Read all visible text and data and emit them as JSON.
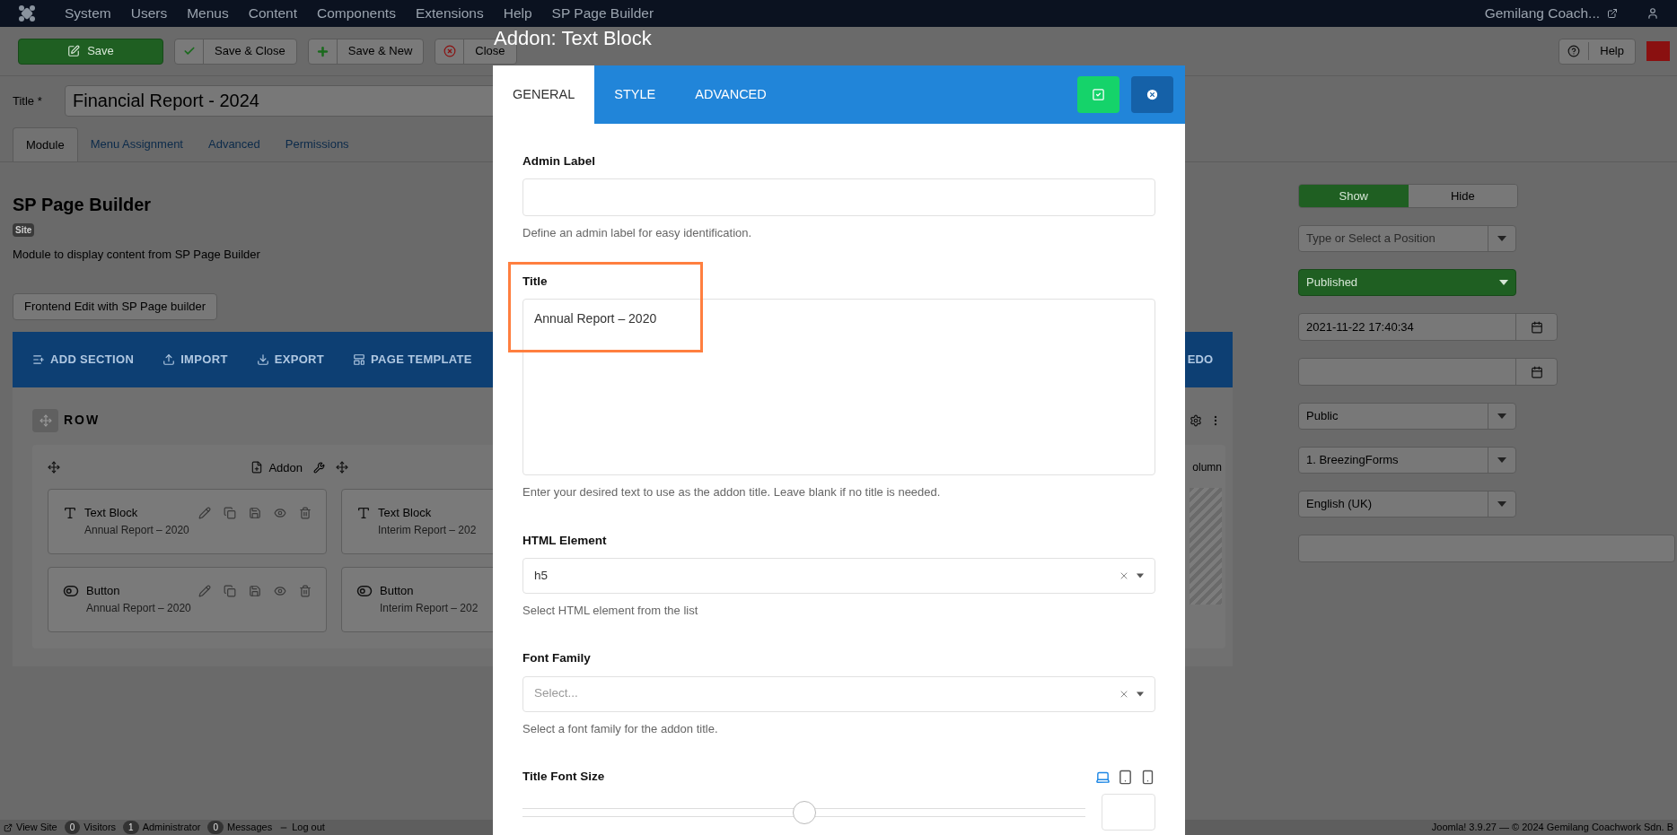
{
  "top_nav": {
    "menu": [
      "System",
      "Users",
      "Menus",
      "Content",
      "Components",
      "Extensions",
      "Help",
      "SP Page Builder"
    ],
    "user_site": "Gemilang Coach..."
  },
  "toolbar": {
    "buttons": [
      {
        "kind": "primary",
        "label": "Save"
      },
      {
        "kind": "check",
        "label": "Save & Close"
      },
      {
        "kind": "plus",
        "label": "Save & New"
      },
      {
        "kind": "cancel",
        "label": "Close"
      }
    ],
    "help": "Help"
  },
  "title_field": {
    "label": "Title *",
    "value": "Financial Report - 2024"
  },
  "tabs": [
    {
      "label": "Module",
      "selected": true
    },
    {
      "label": "Menu Assignment",
      "selected": false
    },
    {
      "label": "Advanced",
      "selected": false
    },
    {
      "label": "Permissions",
      "selected": false
    }
  ],
  "module": {
    "heading": "SP Page Builder",
    "badge": "Site",
    "description": "Module to display content from SP Page Builder",
    "frontend_button": "Frontend Edit with SP Page builder"
  },
  "builder": {
    "toolbar": [
      {
        "kind": "add",
        "label": "ADD SECTION"
      },
      {
        "kind": "import",
        "label": "IMPORT"
      },
      {
        "kind": "export",
        "label": "EXPORT"
      },
      {
        "kind": "template",
        "label": "PAGE TEMPLATE"
      }
    ],
    "toolbar_right": "EDO",
    "row_label": "ROW",
    "addon_button": "Addon",
    "column_label": "olumn",
    "addons": [
      {
        "kind": "text",
        "name": "Text Block",
        "subtitle": "Annual Report – 2020"
      },
      {
        "kind": "text",
        "name": "Text Block",
        "subtitle": "Interim Report – 202"
      },
      {
        "kind": "button",
        "name": "Button",
        "subtitle": "Annual Report – 2020"
      },
      {
        "kind": "button",
        "name": "Button",
        "subtitle": "Interim Report – 202"
      }
    ]
  },
  "sidebar": {
    "visibility": [
      {
        "label": "Show",
        "selected": true
      },
      {
        "label": "Hide",
        "selected": false
      }
    ],
    "fields": [
      {
        "kind": "select",
        "placeholder": "Type or Select a Position"
      },
      {
        "kind": "status",
        "value": "Published"
      },
      {
        "kind": "date",
        "value": "2021-11-22 17:40:34"
      },
      {
        "kind": "date"
      },
      {
        "kind": "select",
        "value": "Public"
      },
      {
        "kind": "select",
        "value": "1. BreezingForms"
      },
      {
        "kind": "select",
        "value": "English (UK)"
      },
      {
        "kind": "text"
      }
    ]
  },
  "dialog": {
    "title": "Addon: Text Block",
    "tabs": [
      {
        "label": "GENERAL",
        "selected": true
      },
      {
        "label": "STYLE",
        "selected": false
      },
      {
        "label": "ADVANCED",
        "selected": false
      }
    ],
    "fields": [
      {
        "kind": "text",
        "label": "Admin Label",
        "help": "Define an admin label for easy identification."
      },
      {
        "kind": "textarea",
        "label": "Title",
        "value": "Annual Report – 2020",
        "highlighted": true,
        "help": "Enter your desired text to use as the addon title. Leave blank if no title is needed."
      },
      {
        "kind": "select",
        "label": "HTML Element",
        "value": "h5",
        "help": "Select HTML element from the list"
      },
      {
        "kind": "select",
        "label": "Font Family",
        "placeholder": "Select...",
        "help": "Select a font family for the addon title."
      },
      {
        "kind": "slider",
        "label": "Title Font Size",
        "level": 0.5,
        "devices": [
          {
            "kind": "desktop",
            "selected": true
          },
          {
            "kind": "tablet",
            "selected": false
          },
          {
            "kind": "mobile",
            "selected": false
          }
        ]
      }
    ]
  },
  "status_bar": {
    "items": [
      {
        "kind": "link",
        "label": "View Site"
      },
      {
        "kind": "count",
        "count": "0",
        "label": "Visitors"
      },
      {
        "kind": "count",
        "count": "1",
        "label": "Administrator"
      },
      {
        "kind": "count",
        "count": "0",
        "label": "Messages"
      },
      {
        "kind": "logout",
        "label": "Log out"
      }
    ],
    "copyright": "Joomla! 3.9.27 — © 2024 Gemilang Coachwork Sdn. B"
  }
}
